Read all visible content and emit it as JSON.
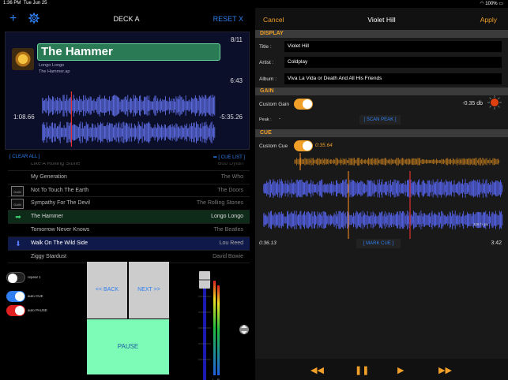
{
  "status": {
    "time": "1:36 PM",
    "date": "Tue Jun 25",
    "battery": "100%"
  },
  "deck": {
    "add_icon": "+",
    "title": "DECK A",
    "reset_label": "RESET X",
    "track": {
      "title": "The Hammer",
      "artist": "Longo Longo",
      "file": "The Hammer.ap",
      "count": "8/11",
      "duration": "6:43",
      "elapsed": "1:08.66",
      "remaining": "-5:35.26",
      "progress": 0.17
    },
    "clear_all": "[ CLEAR ALL ]",
    "cue_list": "➡ [ CUE LIST ]",
    "playlist": [
      {
        "title": "Like A Rolling Stone",
        "artist": "Bob Dylan",
        "state": "faded"
      },
      {
        "title": "My Generation",
        "artist": "The Who",
        "state": "normal"
      },
      {
        "title": "Not To Touch The Earth",
        "artist": "The Doors",
        "state": "normal",
        "tag": "GAIN"
      },
      {
        "title": "Sympathy For The Devil",
        "artist": "The Rolling Stones",
        "state": "normal",
        "tag": "GAIN CUE"
      },
      {
        "title": "The Hammer",
        "artist": "Longo Longo",
        "state": "active",
        "icon": "➡"
      },
      {
        "title": "Tomorrow Never Knows",
        "artist": "The Beatles",
        "state": "normal"
      },
      {
        "title": "Walk On The Wild Side",
        "artist": "Lou Reed",
        "state": "queued",
        "icon": "⬇"
      },
      {
        "title": "Ziggy Stardust",
        "artist": "David Bowie",
        "state": "normal"
      }
    ],
    "toggles": [
      {
        "label": "repeat 1",
        "on": false
      },
      {
        "label": "auto CUE",
        "on": true,
        "color": "#2f7ff0"
      },
      {
        "label": "auto PAUSE",
        "on": true,
        "color": "#e02020"
      }
    ],
    "back_label": "<< BACK",
    "next_label": "NEXT >>",
    "pause_label": "PAUSE",
    "meter_labels": {
      "left": "L",
      "right": "R"
    }
  },
  "editor": {
    "cancel_label": "Cancel",
    "title": "Violet Hill",
    "apply_label": "Apply",
    "display_header": "DISPLAY",
    "title_label": "Title :",
    "title_value": "Violet Hill",
    "artist_label": "Artist :",
    "artist_value": "Coldplay",
    "album_label": "Album :",
    "album_value": "Viva La Vida or Death And All His Friends",
    "gain_header": "GAIN",
    "custom_gain_label": "Custom Gain",
    "gain_value": "-0.35 db",
    "peak_label": "Peak :",
    "peak_value": "-",
    "scan_peak_label": "[ SCAN PEAK ]",
    "cue_header": "CUE",
    "custom_cue_label": "Custom Cue",
    "cue_value": "0:35.64",
    "zoom_label": "128 f / px",
    "cue_time": "0:36.13",
    "mark_cue_label": "[ MARK CUE ]",
    "total_time": "3:42",
    "transport": [
      "◀◀",
      "❚❚",
      "▶",
      "▶▶"
    ]
  },
  "colors": {
    "accent": "#f0a028",
    "link": "#2f7ff0",
    "pause_pad": "#7dfcb8",
    "title_bar": "#2a7b55"
  }
}
